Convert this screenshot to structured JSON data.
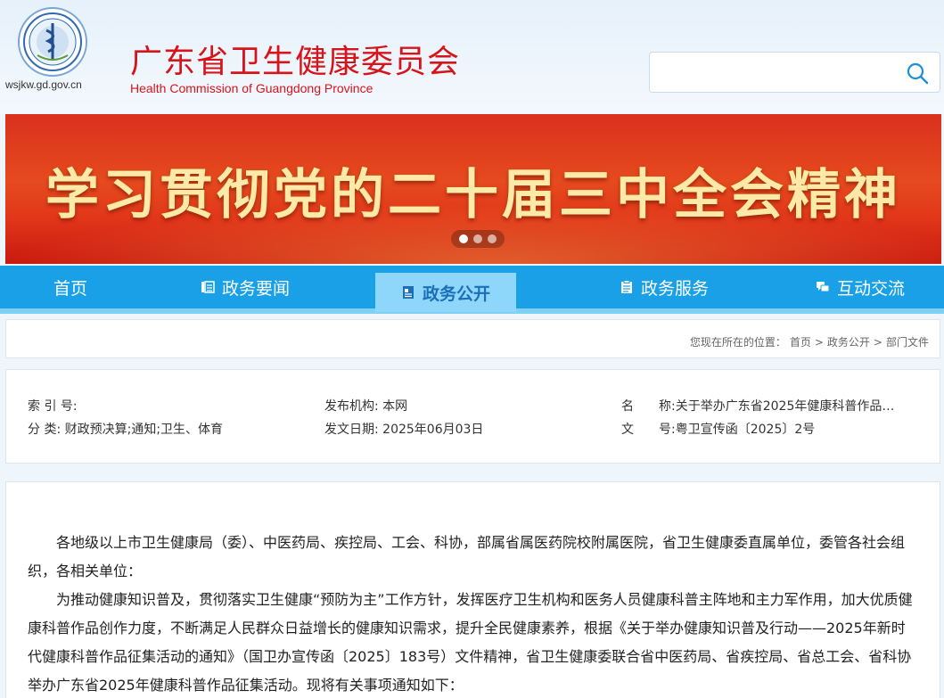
{
  "header": {
    "logo_domain": "wsjkw.gd.gov.cn",
    "title_cn": "广东省卫生健康委员会",
    "title_en": "Health Commission of Guangdong Province",
    "search_placeholder": "",
    "search_value": ""
  },
  "banner": {
    "title": "学习贯彻党的二十届三中全会精神",
    "slide_count": 3,
    "active_slide": 1
  },
  "nav": {
    "items": [
      {
        "label": "首页",
        "icon": "none"
      },
      {
        "label": "政务要闻",
        "icon": "news-icon"
      },
      {
        "label": "政务公开",
        "icon": "document-icon"
      },
      {
        "label": "政务服务",
        "icon": "clipboard-icon"
      },
      {
        "label": "互动交流",
        "icon": "chat-icon"
      }
    ],
    "active_index": 2
  },
  "breadcrumb": {
    "prefix": "您现在所在的位置：",
    "items": [
      "首页",
      "政务公开",
      "部门文件"
    ],
    "separator": ">"
  },
  "meta": {
    "index_no": "索 引 号:",
    "category": "分 类: 财政预决算;通知;卫生、体育",
    "publisher": "发布机构: 本网",
    "pub_date": "发文日期: 2025年06月03日",
    "name_label": "名　　称:",
    "name_value": "关于举办广东省2025年健康科普作品…",
    "doc_label": "文　　号:",
    "doc_value": "粤卫宣传函〔2025〕2号"
  },
  "body": {
    "para1": "各地级以上市卫生健康局（委）、中医药局、疾控局、工会、科协，部属省属医药院校附属医院，省卫生健康委直属单位，委管各社会组织，各相关单位：",
    "para2": "为推动健康知识普及，贯彻落实卫生健康“预防为主”工作方针，发挥医疗卫生机构和医务人员健康科普主阵地和主力军作用，加大优质健康科普作品创作力度，不断满足人民群众日益增长的健康知识需求，提升全民健康素养，根据《关于举办健康知识普及行动——2025年新时代健康科普作品征集活动的通知》（国卫办宣传函〔2025〕183号）文件精神，省卫生健康委联合省中医药局、省疾控局、省总工会、省科协举办广东省2025年健康科普作品征集活动。现将有关事项通知如下："
  },
  "colors": {
    "brand_red": "#d7141a",
    "nav_blue": "#1aa0e6",
    "nav_active": "#8fd6fb"
  }
}
